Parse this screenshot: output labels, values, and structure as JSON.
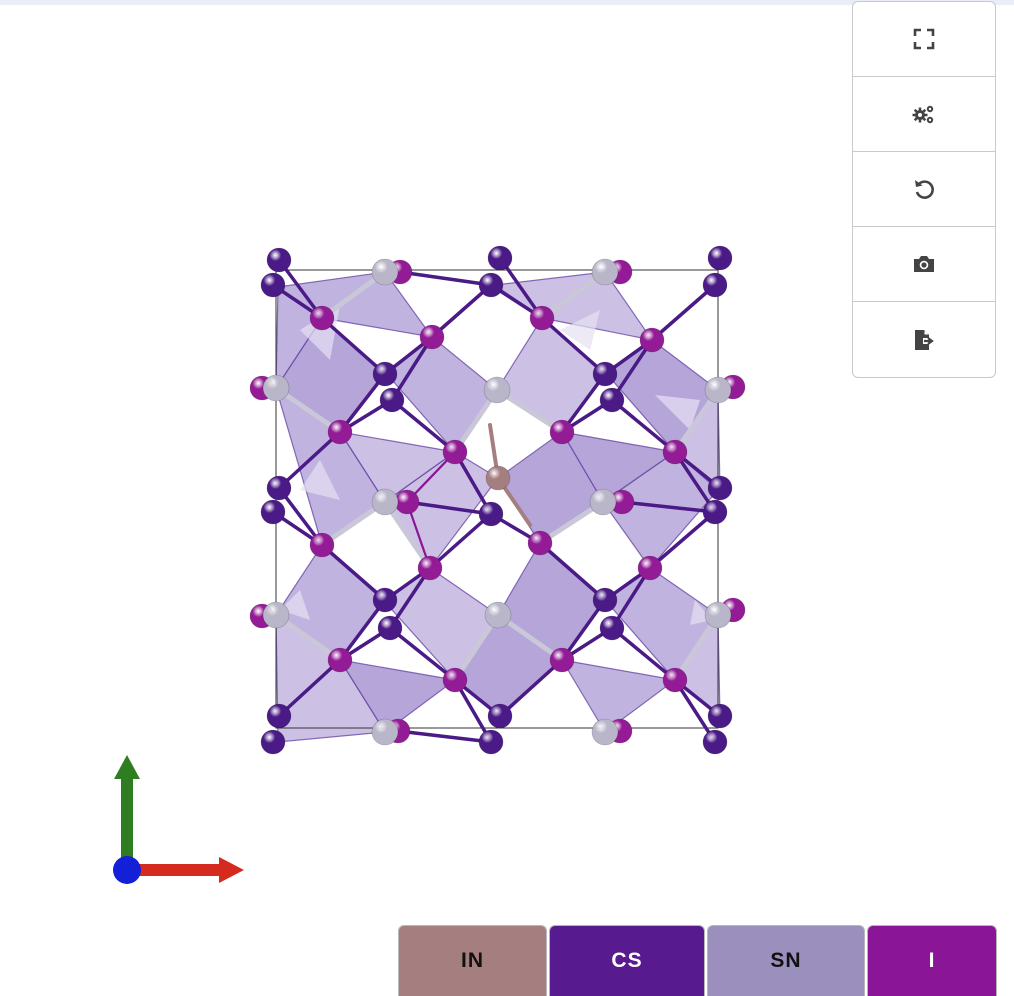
{
  "toolbar": {
    "buttons": [
      {
        "name": "fullscreen-icon"
      },
      {
        "name": "settings-icon"
      },
      {
        "name": "reset-view-icon"
      },
      {
        "name": "camera-icon"
      },
      {
        "name": "export-icon"
      }
    ]
  },
  "legend": [
    {
      "label": "IN",
      "color": "#a57f80",
      "text_color": "#111111"
    },
    {
      "label": "CS",
      "color": "#571b8f",
      "text_color": "#ffffff"
    },
    {
      "label": "SN",
      "color": "#9a8fbd",
      "text_color": "#111111"
    },
    {
      "label": "I",
      "color": "#8a1596",
      "text_color": "#ffffff"
    }
  ],
  "atom_colors": {
    "In": "#a57f80",
    "Cs": "#4a1a86",
    "Sn": "#b8b6c8",
    "I": "#941b96",
    "polyhedra": "#8e74c4"
  },
  "axes": {
    "x_color": "#d42b1e",
    "y_color": "#2e7d20",
    "z_color": "#1320d8"
  }
}
